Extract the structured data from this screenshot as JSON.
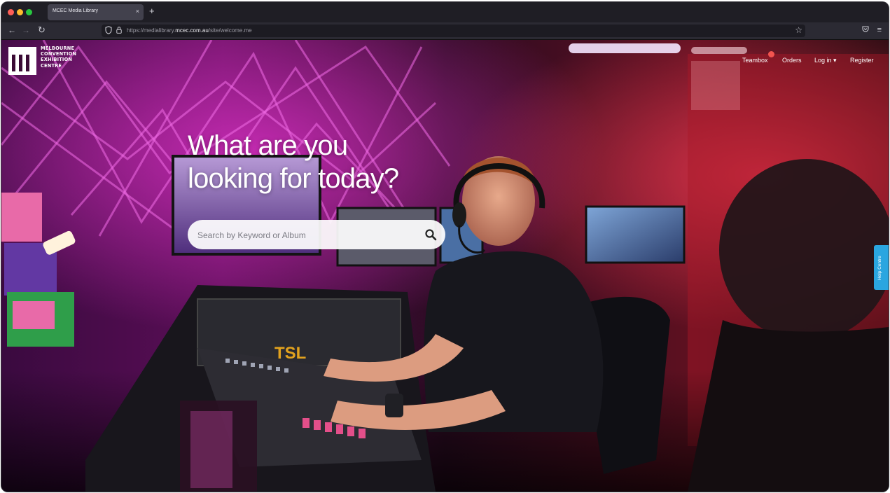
{
  "browser": {
    "tab_title": "MCEC Media Library",
    "tab_close": "×",
    "new_tab": "+",
    "url_prefix": "https://medialibrary.",
    "url_domain": "mcec.com.au",
    "url_path": "/site/welcome.me"
  },
  "site": {
    "logo_text_lines": [
      "MELBOURNE",
      "CONVENTION",
      "EXHIBITION",
      "CENTRE"
    ],
    "nav": {
      "teambox": "Teambox",
      "orders": "Orders",
      "login": "Log in ▾",
      "register": "Register"
    },
    "headline_line1": "What are you",
    "headline_line2": "looking for today?",
    "search_placeholder": "Search by Keyword or Album",
    "help_tab": "Help Centre"
  },
  "colors": {
    "accent_help": "#2aa6e0",
    "notification_dot": "#f2544f"
  },
  "icons": {
    "back": "arrow-left-icon",
    "forward": "arrow-right-icon",
    "reload": "reload-icon",
    "tracking": "shield-icon",
    "lock": "lock-icon",
    "bookmark": "star-icon",
    "pocket": "pocket-icon",
    "menu": "hamburger-menu-icon",
    "search": "search-icon"
  }
}
